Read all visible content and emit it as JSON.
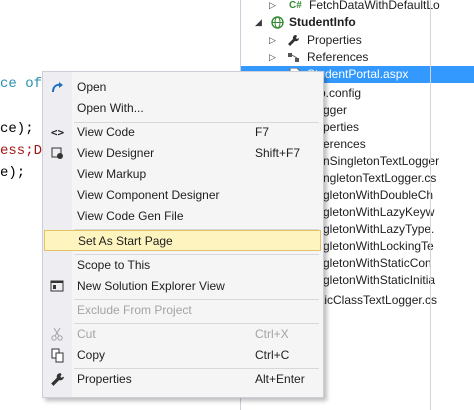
{
  "editor": {
    "lines": [
      {
        "parts": [
          {
            "t": "ce of",
            "c": "teal"
          }
        ]
      },
      {
        "parts": [
          {
            "t": "ce);",
            "c": "black"
          }
        ]
      },
      {
        "parts": [
          {
            "t": "ess;D",
            "c": "red"
          }
        ]
      },
      {
        "parts": [
          {
            "t": "e);",
            "c": "black"
          }
        ]
      }
    ]
  },
  "tree": {
    "rows": [
      {
        "text": "FetchDataWithDefaultLo",
        "icon": "csharp-file-icon",
        "icon_label": "C#"
      },
      {
        "text": "StudentInfo",
        "icon": "web-project-icon"
      },
      {
        "text": "Properties",
        "icon": "wrench-icon"
      },
      {
        "text": "References",
        "icon": "references-icon"
      },
      {
        "text": "StudentPortal.aspx",
        "icon": "aspx-file-icon"
      },
      {
        "text": "b.config"
      },
      {
        "text": "gger"
      },
      {
        "text": "perties"
      },
      {
        "text": "erences"
      },
      {
        "text": "nSingletonTextLogger"
      },
      {
        "text": "ngletonTextLogger.cs"
      },
      {
        "text": "gletonWithDoubleCh"
      },
      {
        "text": "gletonWithLazyKeyw"
      },
      {
        "text": "gletonWithLazyType."
      },
      {
        "text": "gletonWithLockingTe"
      },
      {
        "text": "gletonWithStaticCon"
      },
      {
        "text": "gletonWithStaticInitia"
      },
      {
        "text": "ticClassTextLogger.cs"
      }
    ]
  },
  "menu": {
    "items": [
      {
        "label": "Open",
        "icon": "open-icon",
        "shortcut": ""
      },
      {
        "label": "Open With...",
        "icon": "",
        "shortcut": ""
      },
      {
        "label": "View Code",
        "icon": "view-code-icon",
        "shortcut": "F7"
      },
      {
        "label": "View Designer",
        "icon": "view-designer-icon",
        "shortcut": "Shift+F7"
      },
      {
        "label": "View Markup",
        "icon": "",
        "shortcut": ""
      },
      {
        "label": "View Component Designer",
        "icon": "",
        "shortcut": ""
      },
      {
        "label": "View Code Gen File",
        "icon": "",
        "shortcut": ""
      },
      {
        "label": "Set As Start Page",
        "icon": "",
        "shortcut": "",
        "highlighted": true
      },
      {
        "label": "Scope to This",
        "icon": "",
        "shortcut": ""
      },
      {
        "label": "New Solution Explorer View",
        "icon": "new-view-icon",
        "shortcut": ""
      },
      {
        "label": "Exclude From Project",
        "icon": "",
        "shortcut": "",
        "disabled": true
      },
      {
        "label": "Cut",
        "icon": "cut-icon",
        "shortcut": "Ctrl+X",
        "disabled": true
      },
      {
        "label": "Copy",
        "icon": "copy-icon",
        "shortcut": "Ctrl+C"
      },
      {
        "label": "Properties",
        "icon": "wrench-icon",
        "shortcut": "Alt+Enter"
      }
    ]
  },
  "colors": {
    "selection": "#3399ff",
    "menu_highlight": "#fdf4bf",
    "open_icon": "#1e6fbf"
  }
}
